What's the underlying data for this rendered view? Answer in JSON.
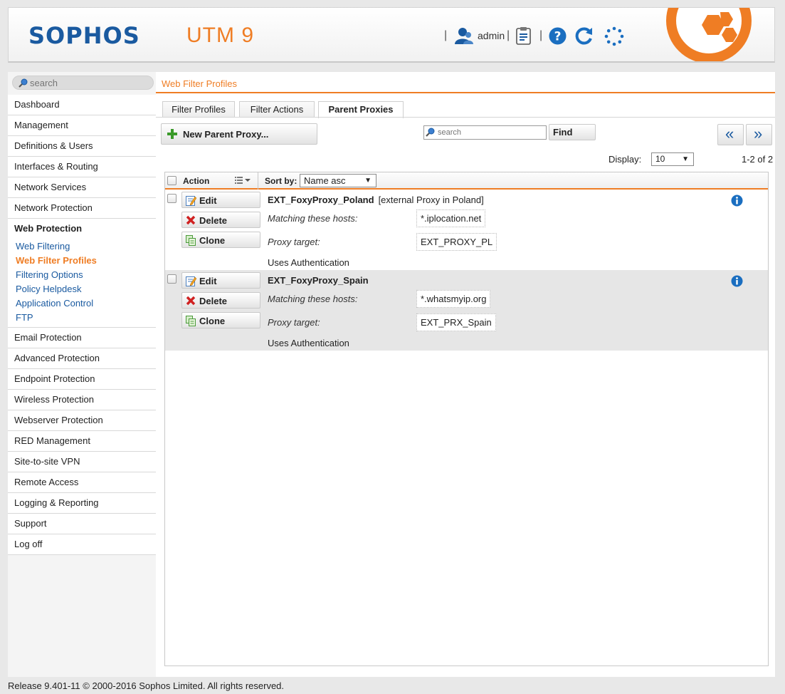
{
  "header": {
    "brand": "SOPHOS",
    "product": "UTM 9",
    "user": "admin",
    "icons": [
      "user-icon",
      "clipboard-icon",
      "help-icon",
      "reload-icon",
      "activity-spinner-icon"
    ],
    "brand_color": "#1a5aa0",
    "accent_color": "#ef7d24"
  },
  "sidebar": {
    "search_placeholder": "search",
    "items": [
      {
        "label": "Dashboard"
      },
      {
        "label": "Management"
      },
      {
        "label": "Definitions & Users"
      },
      {
        "label": "Interfaces & Routing"
      },
      {
        "label": "Network Services"
      },
      {
        "label": "Network Protection"
      },
      {
        "label": "Web Protection"
      },
      {
        "label": "Email Protection"
      },
      {
        "label": "Advanced Protection"
      },
      {
        "label": "Endpoint Protection"
      },
      {
        "label": "Wireless Protection"
      },
      {
        "label": "Webserver Protection"
      },
      {
        "label": "RED Management"
      },
      {
        "label": "Site-to-site VPN"
      },
      {
        "label": "Remote Access"
      },
      {
        "label": "Logging & Reporting"
      },
      {
        "label": "Support"
      },
      {
        "label": "Log off"
      }
    ],
    "web_protection_sub": [
      {
        "label": "Web Filtering"
      },
      {
        "label": "Web Filter Profiles",
        "active": true
      },
      {
        "label": "Filtering Options"
      },
      {
        "label": "Policy Helpdesk"
      },
      {
        "label": "Application Control"
      },
      {
        "label": "FTP"
      }
    ]
  },
  "main": {
    "title": "Web Filter Profiles",
    "tabs": [
      {
        "label": "Filter Profiles"
      },
      {
        "label": "Filter Actions"
      },
      {
        "label": "Parent Proxies",
        "active": true
      }
    ],
    "new_button": "New Parent Proxy...",
    "find_placeholder": "search",
    "find_button": "Find",
    "prev_button": "«",
    "next_button": "»",
    "display_label": "Display:",
    "display_value": "10",
    "range": "1-2 of 2",
    "list_header": {
      "action_label": "Action",
      "sort_label": "Sort by:",
      "sort_value": "Name asc"
    },
    "rows": [
      {
        "name": "EXT_FoxyProxy_Poland",
        "comment": "[external Proxy in Poland]",
        "hosts_label": "Matching these hosts:",
        "hosts": "*.iplocation.net",
        "target_label": "Proxy target:",
        "target": "EXT_PROXY_PL",
        "auth": "Uses Authentication",
        "edit": "Edit",
        "delete": "Delete",
        "clone": "Clone"
      },
      {
        "name": "EXT_FoxyProxy_Spain",
        "comment": "",
        "hosts_label": "Matching these hosts:",
        "hosts": "*.whatsmyip.org",
        "target_label": "Proxy target:",
        "target": "EXT_PRX_Spain",
        "auth": "Uses Authentication",
        "edit": "Edit",
        "delete": "Delete",
        "clone": "Clone"
      }
    ]
  },
  "footer": "Release 9.401-11  © 2000-2016 Sophos Limited. All rights reserved."
}
